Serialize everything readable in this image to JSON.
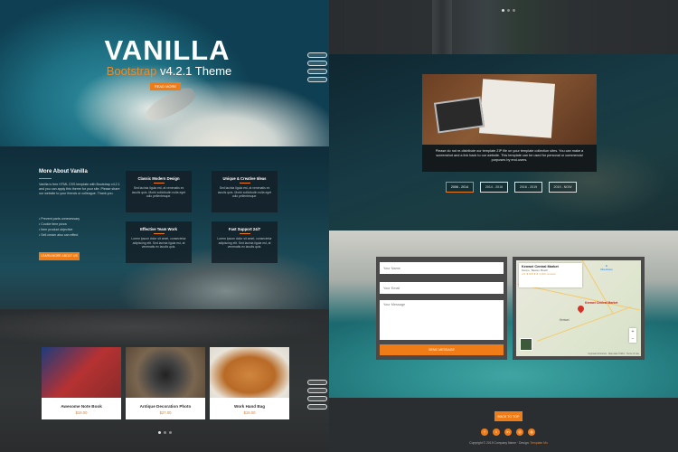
{
  "hero": {
    "title": "VANILLA",
    "subtitle_orange": "Bootstrap",
    "subtitle_rest": " v4.2.1 Theme",
    "button_label": "READ MORE"
  },
  "about": {
    "title": "More About Vanilla",
    "text": "Vanilla is free HTML CSS template with Bootstrap v4.2.1 and you can apply this theme for your site. Please share our website to your friends or colleague. Thank you.",
    "list": [
      "Prevent parts unnecessary",
      "Cookie time pizza",
      "Item product objective",
      "Sell cream also can effect"
    ],
    "button_label": "LEARN MORE ABOUT US",
    "features": [
      {
        "title": "Classic Modern Design",
        "desc": "Sed lacinia ligula est, at venenatis ex iaculis quis. Morbi sollicitudin nulla eget odio pellentesque."
      },
      {
        "title": "Unique & Creative Ideas",
        "desc": "Sed lacinia ligula est, at venenatis ex iaculis quis. Morbi sollicitudin nulla eget odio pellentesque."
      },
      {
        "title": "Effective Team Work",
        "desc": "Lorem ipsum dolor sit amet, consectetur adipiscing elit. Sed lacinia ligula est, at venenatis ex iaculis quis."
      },
      {
        "title": "Fast Support 24/7",
        "desc": "Lorem ipsum dolor sit amet, consectetur adipiscing elit. Sed lacinia ligula est, at venenatis ex iaculis quis."
      }
    ]
  },
  "products": [
    {
      "name": "Awesome Note Book",
      "price": "$18.00"
    },
    {
      "name": "Antique Decoration Photo",
      "price": "$27.00"
    },
    {
      "name": "Work Hand Bag",
      "price": "$18.00"
    }
  ],
  "gallery": {
    "caption": "Please do not re-distribute our template ZIP file on your template collection sites. You can make a screenshot and a link back to our website. This template can be used for personal or commercial purposes by end-users."
  },
  "timeline": [
    "2006 - 2014",
    "2014 - 2016",
    "2016 - 2019",
    "2019 - NOW"
  ],
  "contact": {
    "name_placeholder": "Your Name",
    "email_placeholder": "Your Email",
    "message_placeholder": "Your Message",
    "send_label": "SEND MESSAGE"
  },
  "map": {
    "title": "Kenwei Central Market",
    "address": "Kenpo, Taiwan, Brazil",
    "rating": "4.5 ★★★★★ 3,000 reviews",
    "directions": "Directions",
    "label": "Kenwei Central Market",
    "place": "Kenwei",
    "footer": "Keyboard shortcuts · Map data ©2019 · Terms of Use"
  },
  "footer": {
    "back_label": "BACK TO TOP",
    "social_icons": [
      "facebook-icon",
      "twitter-icon",
      "linkedin-icon",
      "instagram-icon",
      "dribbble-icon"
    ],
    "copyright": "Copyright © 2019 Company Name · Design: ",
    "designer": "Template Mo"
  },
  "colors": {
    "accent": "#f07c18"
  }
}
